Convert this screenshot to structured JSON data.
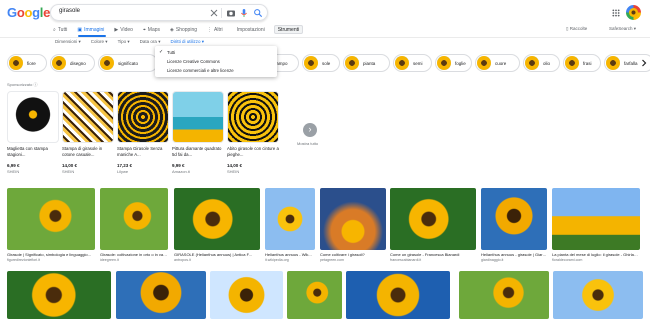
{
  "header": {
    "logo_letters": [
      {
        "ch": "G",
        "color": "#4285F4"
      },
      {
        "ch": "o",
        "color": "#EA4335"
      },
      {
        "ch": "o",
        "color": "#FBBC05"
      },
      {
        "ch": "g",
        "color": "#4285F4"
      },
      {
        "ch": "l",
        "color": "#34A853"
      },
      {
        "ch": "e",
        "color": "#EA4335"
      }
    ],
    "search_query": "girasole",
    "icons": [
      "close-icon",
      "camera-icon",
      "mic-icon",
      "search-icon"
    ]
  },
  "tabs": [
    {
      "label": "Tutti",
      "icon": "search-icon",
      "active": false
    },
    {
      "label": "Immagini",
      "icon": "image-icon",
      "active": true
    },
    {
      "label": "Video",
      "icon": "video-icon",
      "active": false
    },
    {
      "label": "Maps",
      "icon": "map-icon",
      "active": false
    },
    {
      "label": "Shopping",
      "icon": "tag-icon",
      "active": false
    },
    {
      "label": "Altri",
      "icon": "dots-icon",
      "active": false
    },
    {
      "label": "Impostazioni",
      "icon": "",
      "active": false
    },
    {
      "label": "Strumenti",
      "icon": "",
      "active": false
    }
  ],
  "top_right": {
    "raccolte": "Raccolte",
    "safesearch": "SafeSearch"
  },
  "filters": [
    "Dimensioni",
    "Colore",
    "Tipo",
    "Data ora",
    "Diritti di utilizzo"
  ],
  "dropdown": {
    "items": [
      "Tutti",
      "Licenze Creative Commons",
      "Licenze commerciali e altre licenze"
    ],
    "selected": "Tutti"
  },
  "chips": [
    "fiore",
    "disegno",
    "significato",
    "",
    "campo",
    "sole",
    "pianta",
    "semi",
    "foglie",
    "cuore",
    "olio",
    "frasi",
    "farfalla"
  ],
  "sponsored_label": "Sponsorizzato",
  "ads": [
    {
      "title": "Maglietta con stampa stagioni...",
      "price": "6,99 €",
      "shop": "SHEIN"
    },
    {
      "title": "Stampa di girasole in cotone casuale...",
      "price": "14,00 €",
      "shop": "SHEIN"
    },
    {
      "title": "Stampa Girasole Senza maniche A...",
      "price": "17,23 €",
      "shop": "Lilywe"
    },
    {
      "title": "Pittura diamante quadrato 5d fai da...",
      "price": "9,99 €",
      "shop": "Amazon.it"
    },
    {
      "title": "Abito girasole con cinture a pieghe...",
      "price": "14,00 €",
      "shop": "SHEIN"
    }
  ],
  "more": "Mostra tutto",
  "results_row1": [
    {
      "cap": "Girasole | Significato, simbologia e linguaggio...",
      "src": "figuredirezioniefiori.it"
    },
    {
      "cap": "Girasole: coltivazione in orto o in vaso...",
      "src": "ideegreen.it"
    },
    {
      "cap": "GIRASOLE (Helianthus annuus) | Antica F...",
      "src": "antropos.it"
    },
    {
      "cap": "Helianthus annuus - Wik...",
      "src": "it.wikipedia.org"
    },
    {
      "cap": "Come coltivare i girasoli?",
      "src": "petagreen.com"
    },
    {
      "cap": "Come un girasole - Francesca Bianardi",
      "src": "francescabianardi.it"
    },
    {
      "cap": "Helianthus annuus - girasole | Giardi...",
      "src": "giardinaggio.it"
    },
    {
      "cap": "La pianta del mese di luglio: il girasole - Ghirlanda",
      "src": "floraldecorami.com"
    }
  ],
  "results_row2": [
    {
      "cap": "",
      "src": ""
    },
    {
      "cap": "",
      "src": ""
    },
    {
      "cap": "",
      "src": ""
    },
    {
      "cap": "",
      "src": ""
    },
    {
      "cap": "",
      "src": ""
    },
    {
      "cap": "",
      "src": ""
    }
  ]
}
